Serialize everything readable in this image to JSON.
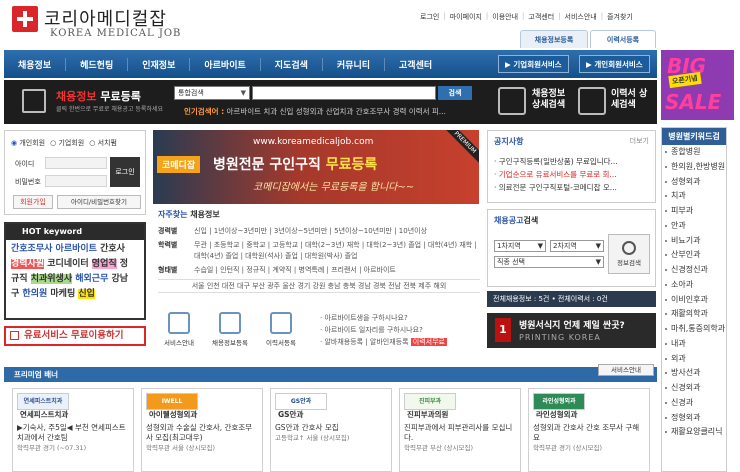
{
  "logo": {
    "ko": "코리아메디컬잡",
    "en": "KOREA MEDICAL JOB"
  },
  "toplinks": [
    "로그인",
    "마이페이지",
    "이용안내",
    "고객센터",
    "서비스안내",
    "즐겨찾기"
  ],
  "tabs": {
    "person": "채용정보등록",
    "resume": "이력서등록"
  },
  "nav": {
    "items": [
      "채용정보",
      "헤드헌팅",
      "인재정보",
      "아르바이트",
      "지도검색",
      "커뮤니티",
      "고객센터"
    ],
    "svc1": "기업회원서비스",
    "svc2": "개인회원서비스"
  },
  "band": {
    "reg_title_red": "채용정보",
    "reg_title_white": "무료등록",
    "reg_sub": "클릭 한번으로 무료로 채용공고 등록하세요",
    "search_select": "통합검색",
    "search_button": "검색",
    "search_placeholder": "",
    "popular_label": "인기검색어 :",
    "popular_terms": "아르바이트 치과 신입 성형외과 산업치과 간호조무사 경력 이력서 피...",
    "job_detail": "채용정보 상세검색",
    "resume_detail": "이력서 상세검색"
  },
  "login": {
    "radio1": "개인회원",
    "radio2": "기업회원",
    "radio3": "서치펌",
    "id_label": "아이디",
    "pw_label": "비밀번호",
    "login_btn": "로그인",
    "join_btn": "회원가입",
    "find_btn": "아이디/비밀번호찾기"
  },
  "hot": {
    "title": "HOT keyword",
    "lines": [
      [
        {
          "t": "간호조무사",
          "c": "#2b55a8",
          "bg": ""
        },
        {
          "t": " 아르바이트",
          "c": "#2b55a8",
          "bg": ""
        },
        {
          "t": " 간호사",
          "c": "#333",
          "bg": ""
        }
      ],
      [
        {
          "t": "경력사원",
          "c": "#fff",
          "bg": "#e55"
        },
        {
          "t": " 코디네이터 ",
          "c": "#333",
          "bg": ""
        },
        {
          "t": "영업직",
          "c": "#333",
          "bg": "#f6a5d3"
        },
        {
          "t": " 정",
          "c": "#333",
          "bg": ""
        }
      ],
      [
        {
          "t": "규직 ",
          "c": "#333",
          "bg": ""
        },
        {
          "t": "치과위생사",
          "c": "#333",
          "bg": "#a9d98c"
        },
        {
          "t": " 해외근무",
          "c": "#2b55a8",
          "bg": ""
        },
        {
          "t": " 강남",
          "c": "#333",
          "bg": ""
        }
      ],
      [
        {
          "t": "구 ",
          "c": "#333",
          "bg": ""
        },
        {
          "t": "한의원",
          "c": "#2b55a8",
          "bg": ""
        },
        {
          "t": " 마케팅 ",
          "c": "#333",
          "bg": ""
        },
        {
          "t": "신입",
          "c": "#333",
          "bg": "#ffe200"
        }
      ]
    ]
  },
  "paid_text": "유료서비스 무료이용하기",
  "banner": {
    "url": "www.koreamedicaljob.com",
    "tag": "코메디잡",
    "headline_white": "병원전문 구인구직",
    "headline_yellow": "무료등록",
    "sub": "코메디잡에서는 무료등록을 합니다~~",
    "corner": "PREMIUM"
  },
  "quick": {
    "title_red": "자주찾는",
    "title": "채용정보",
    "rows": [
      {
        "k": "경력별",
        "v": "신입 | 1년이상~3년미만 | 3년이상~5년미만 | 5년이상~10년미만 | 10년이상"
      },
      {
        "k": "학력별",
        "v": "무관 | 초등학교 | 중학교 | 고등학교 | 대학(2~3년) 재학 | 대학(2~3년) 졸업 | 대학(4년) 재학 | 대학(4년) 졸업 | 대학원(석사) 졸업 | 대학원(박사) 졸업"
      },
      {
        "k": "형태별",
        "v": "수습일 | 인턴직 | 정규직 | 계약직 | 병역특례 | 프리랜서 | 아르바이트"
      }
    ],
    "regions": "서울 인천 대전 대구 부산 광주 울산 경기 강원 충남 충북 경남 경북 전남 전북 제주 해외"
  },
  "icons": [
    "서비스안내",
    "채용정보등록",
    "이력서등록"
  ],
  "faq": [
    "아르바이트생을 구하시나요?",
    "아르바이트 일자리를 구하시나요?",
    "알바채용등록 | 알바인재등록"
  ],
  "faq_badge": "이력서무료",
  "notice": {
    "title": "공지사항",
    "more": "더보기",
    "items": [
      {
        "t": "구인구직등록(일반상품) 무료입니다...",
        "red": false
      },
      {
        "t": "기업순으로 유료서비스를 무료로 회...",
        "red": true
      },
      {
        "t": "의료전문 구인구직포털-코메디잡 오...",
        "red": false
      }
    ]
  },
  "corp": {
    "title_red": "채용공고",
    "title": "검색",
    "sel1": "1차지역",
    "sel2": "2차지역",
    "sel3": "직종 선택",
    "btn": "정보검색"
  },
  "count": "전체채용정보 : 5건 • 전체이력서 : 0건",
  "ad2": {
    "title": "병원서식지 언제 제일 싼곳?",
    "sub": "PRINTING KOREA",
    "num": "1"
  },
  "sidebar": {
    "title": "병원별키워드검",
    "items": [
      "종합병원",
      "한의원,한방병원",
      "성형외과",
      "치과",
      "피부과",
      "안과",
      "비뇨기과",
      "산부인과",
      "신경정신과",
      "소아과",
      "이비인후과",
      "재활의학과",
      "마취,통증의학과",
      "내과",
      "외과",
      "방사선과",
      "신경외과",
      "신경과",
      "정형외과",
      "재활요양클리닉"
    ]
  },
  "sale": {
    "line1": "BIG",
    "line2": "SALE",
    "badge": "오픈기념"
  },
  "premium": {
    "title": "프리미엄 배너",
    "more": "서비스안내"
  },
  "cards": [
    {
      "logo": "연세피스트치과",
      "name": "연세피스트치과",
      "desc": "▶기숙사, 주5일◀ 부천 연세피스트치과에서 간호팀",
      "meta": "학력무관 경기 (~07.31)",
      "lc": "#2b4f8a",
      "lbg": "#eaf1fa"
    },
    {
      "logo": "IWELL",
      "name": "아이웰성형외과",
      "desc": "성형외과 수술실 간호사, 간호조무사 모집(최고대우)",
      "meta": "학력무관 서울 (상시모집)",
      "lc": "#fff",
      "lbg": "#f39a1c"
    },
    {
      "logo": "GS안과",
      "name": "GS안과",
      "desc": "GS안과 간호사 모집",
      "meta": "고등학교↑ 서울 (상시모집)",
      "lc": "#1d4b8a",
      "lbg": "#fff"
    },
    {
      "logo": "진피부과",
      "name": "진피부과의원",
      "desc": "진피부과에서 피부관리사를 모십니다.",
      "meta": "학력무관 부산 (상시모집)",
      "lc": "#3c8a3c",
      "lbg": "#f3f8ef"
    },
    {
      "logo": "라인성형외과",
      "name": "라인성형외과",
      "desc": "성형외과 간호사 간호 조무사 구해요",
      "meta": "학력무관 경기 (상시모집)",
      "lc": "#fff",
      "lbg": "#2e8a57"
    }
  ]
}
